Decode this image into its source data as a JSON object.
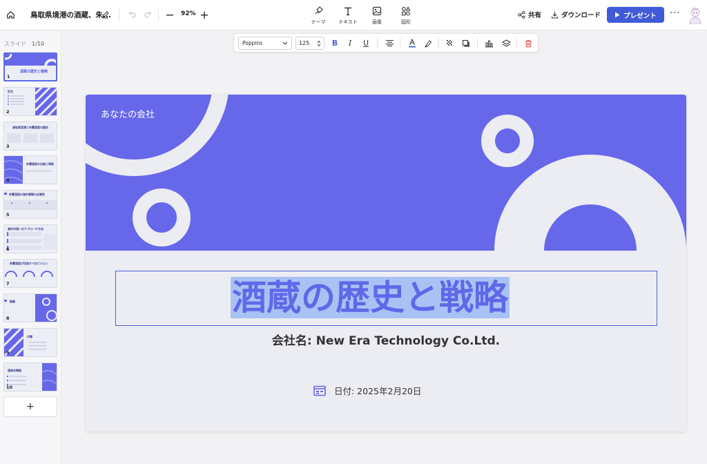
{
  "app": {
    "document_title": "鳥取県境港の酒蔵、朱...",
    "zoom": "92%"
  },
  "toolbar": {
    "tools": [
      {
        "label": "テーマ",
        "icon": "theme-icon"
      },
      {
        "label": "テキスト",
        "icon": "text-icon"
      },
      {
        "label": "画像",
        "icon": "image-icon"
      },
      {
        "label": "図形",
        "icon": "shapes-icon"
      }
    ],
    "share_label": "共有",
    "download_label": "ダウンロード",
    "present_label": "プレゼント",
    "more_label": "···"
  },
  "sidebar": {
    "label": "スライド",
    "count": "1/10",
    "add_label": "+",
    "thumbnails": [
      {
        "number": "1",
        "title": "酒蔵の歴史と戦略"
      },
      {
        "number": "2",
        "title": "目次"
      },
      {
        "number": "3",
        "title": "鳥取県境港と朱鷺酒造の歴史"
      },
      {
        "number": "4",
        "title": "朱鷺酒造の伝統と革新"
      },
      {
        "number": "5",
        "title": "朱鷺酒造の海外戦略の必要性"
      },
      {
        "number": "6",
        "title": "海外市場へのアプローチ方法"
      },
      {
        "number": "7",
        "title": "朱鷺酒造が目指すべきビジョン"
      },
      {
        "number": "8",
        "title": "結論"
      },
      {
        "number": "9",
        "title": "付録"
      },
      {
        "number": "10",
        "title": "連絡先情報"
      }
    ]
  },
  "format_bar": {
    "font": "Poppins",
    "font_size": "125"
  },
  "slide": {
    "company_label": "あなたの会社",
    "title": "酒蔵の歴史と戦略",
    "subtitle": "会社名: New Era Technology Co.Ltd.",
    "date": "日付: 2025年2月20日"
  },
  "colors": {
    "accent": "#6767ea",
    "present_button": "#3f5bd8",
    "selection": "#a9c2f4"
  }
}
